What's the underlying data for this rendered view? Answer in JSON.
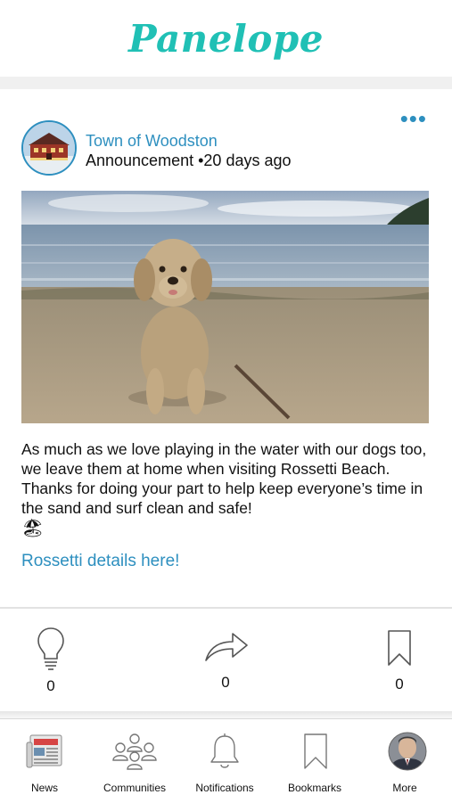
{
  "app": {
    "title": "Panelope"
  },
  "post": {
    "author": "Town of Woodston",
    "type": "Announcement",
    "separator": "•",
    "time": "20 days ago",
    "text": "As much as we love playing in the water with our dogs too, we leave them at home when visiting Rossetti Beach. Thanks for doing your part to help keep everyone’s time in the sand and surf clean and safe!",
    "emoji": "🏖",
    "link": "Rossetti details here!",
    "more_icon": "more-dots-icon",
    "image": "dog-on-beach-photo"
  },
  "actions": {
    "like_count": "0",
    "share_count": "0",
    "bookmark_count": "0"
  },
  "tabs": [
    {
      "label": "News",
      "icon": "newspaper-icon"
    },
    {
      "label": "Communities",
      "icon": "people-icon"
    },
    {
      "label": "Notifications",
      "icon": "bell-icon"
    },
    {
      "label": "Bookmarks",
      "icon": "bookmark-icon"
    },
    {
      "label": "More",
      "icon": "profile-avatar"
    }
  ],
  "colors": {
    "brand": "#20c0b5",
    "link": "#2d8fbf"
  }
}
